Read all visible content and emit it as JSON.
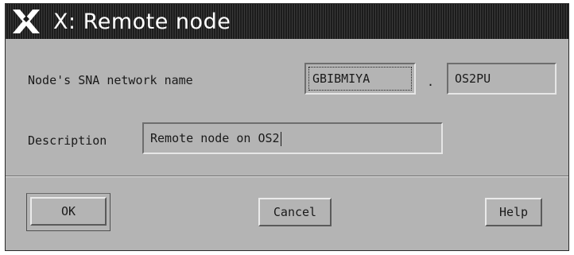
{
  "window": {
    "title": "X: Remote node",
    "title_icon": "x-window-system-logo"
  },
  "form": {
    "network_name_label": "Node's SNA network name",
    "network_id_value": "GBIBMIYA",
    "separator": ".",
    "node_name_value": "OS2PU",
    "description_label": "Description",
    "description_value": "Remote node on OS2"
  },
  "buttons": {
    "ok": "OK",
    "cancel": "Cancel",
    "help": "Help"
  },
  "colors": {
    "background": "#b4b4b4",
    "titlebar": "#1c1c1c",
    "title_text": "#ffffff"
  }
}
